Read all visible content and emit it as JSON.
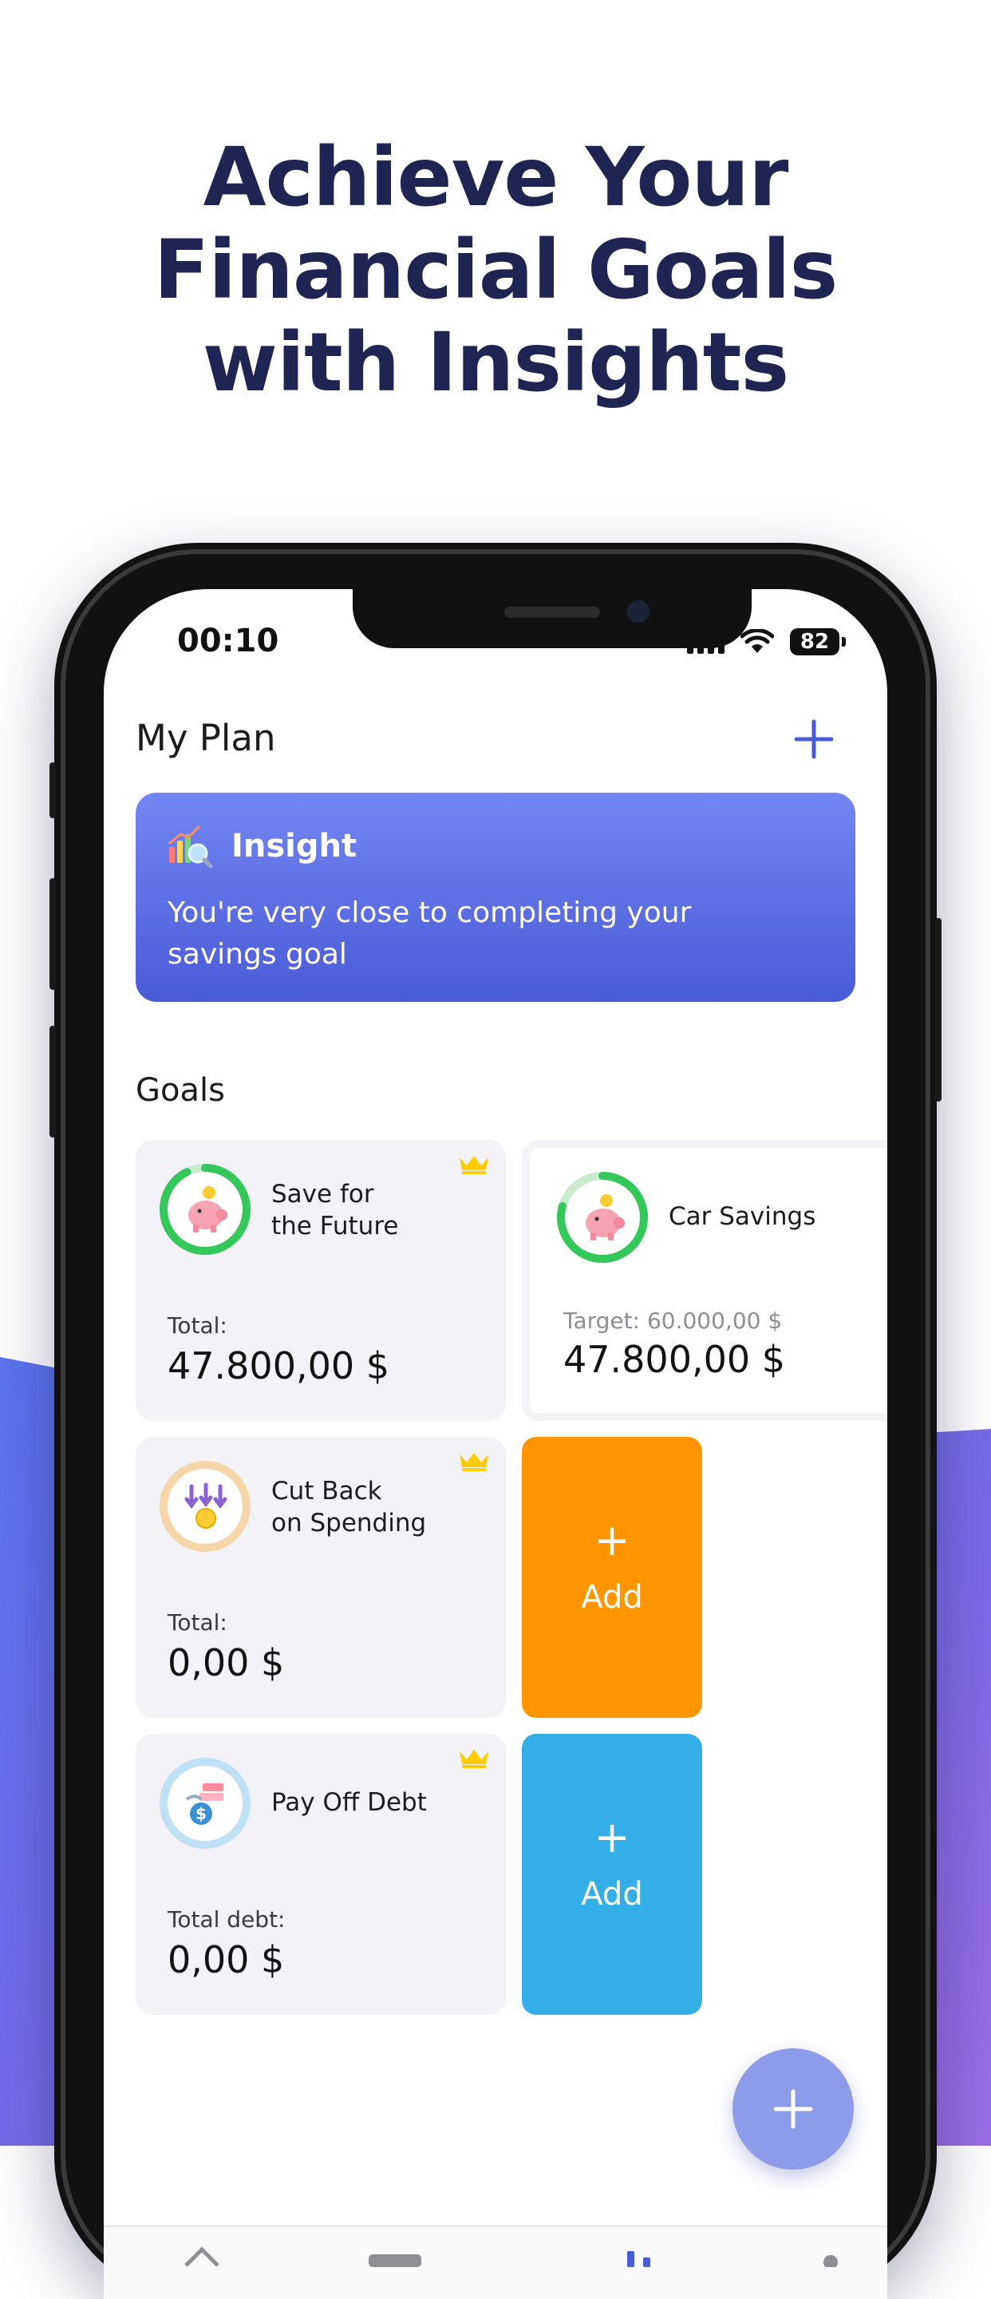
{
  "headline": {
    "line1": "Achieve Your",
    "line2": "Financial Goals",
    "line3": "with Insights"
  },
  "status_bar": {
    "time": "00:10",
    "battery": "82"
  },
  "header": {
    "title": "My Plan",
    "add_icon": "plus-icon"
  },
  "insight": {
    "icon": "chart-magnifier-icon",
    "title": "Insight",
    "text": "You're very close to completing your savings goal"
  },
  "goals": {
    "title": "Goals",
    "items": [
      {
        "label_line1": "Save for",
        "label_line2": "the Future",
        "sub": "Total:",
        "amount": "47.800,00 $",
        "icon": "piggy-bank-icon",
        "premium": true
      },
      {
        "label_line1": "Car Savings",
        "sub": "Target: 60.000,00 $",
        "amount": "47.800,00 $",
        "icon": "piggy-bank-icon",
        "premium": false
      },
      {
        "label_line1": "Cut Back",
        "label_line2": "on Spending",
        "sub": "Total:",
        "amount": "0,00 $",
        "icon": "coins-down-icon",
        "premium": true
      },
      {
        "label_line1": "Pay Off Debt",
        "sub": "Total debt:",
        "amount": "0,00 $",
        "icon": "debt-icon",
        "premium": true
      }
    ],
    "add_tiles": [
      {
        "plus": "+",
        "label": "Add",
        "color": "#ff9500"
      },
      {
        "plus": "+",
        "label": "Add",
        "color": "#34aee6"
      }
    ]
  },
  "colors": {
    "headline": "#1f2452",
    "accent": "#4a5bd6",
    "ring_green": "#34c759",
    "crown": "#ffcc00",
    "fab": "#8c9cea"
  },
  "fab": {
    "icon": "plus-icon"
  }
}
